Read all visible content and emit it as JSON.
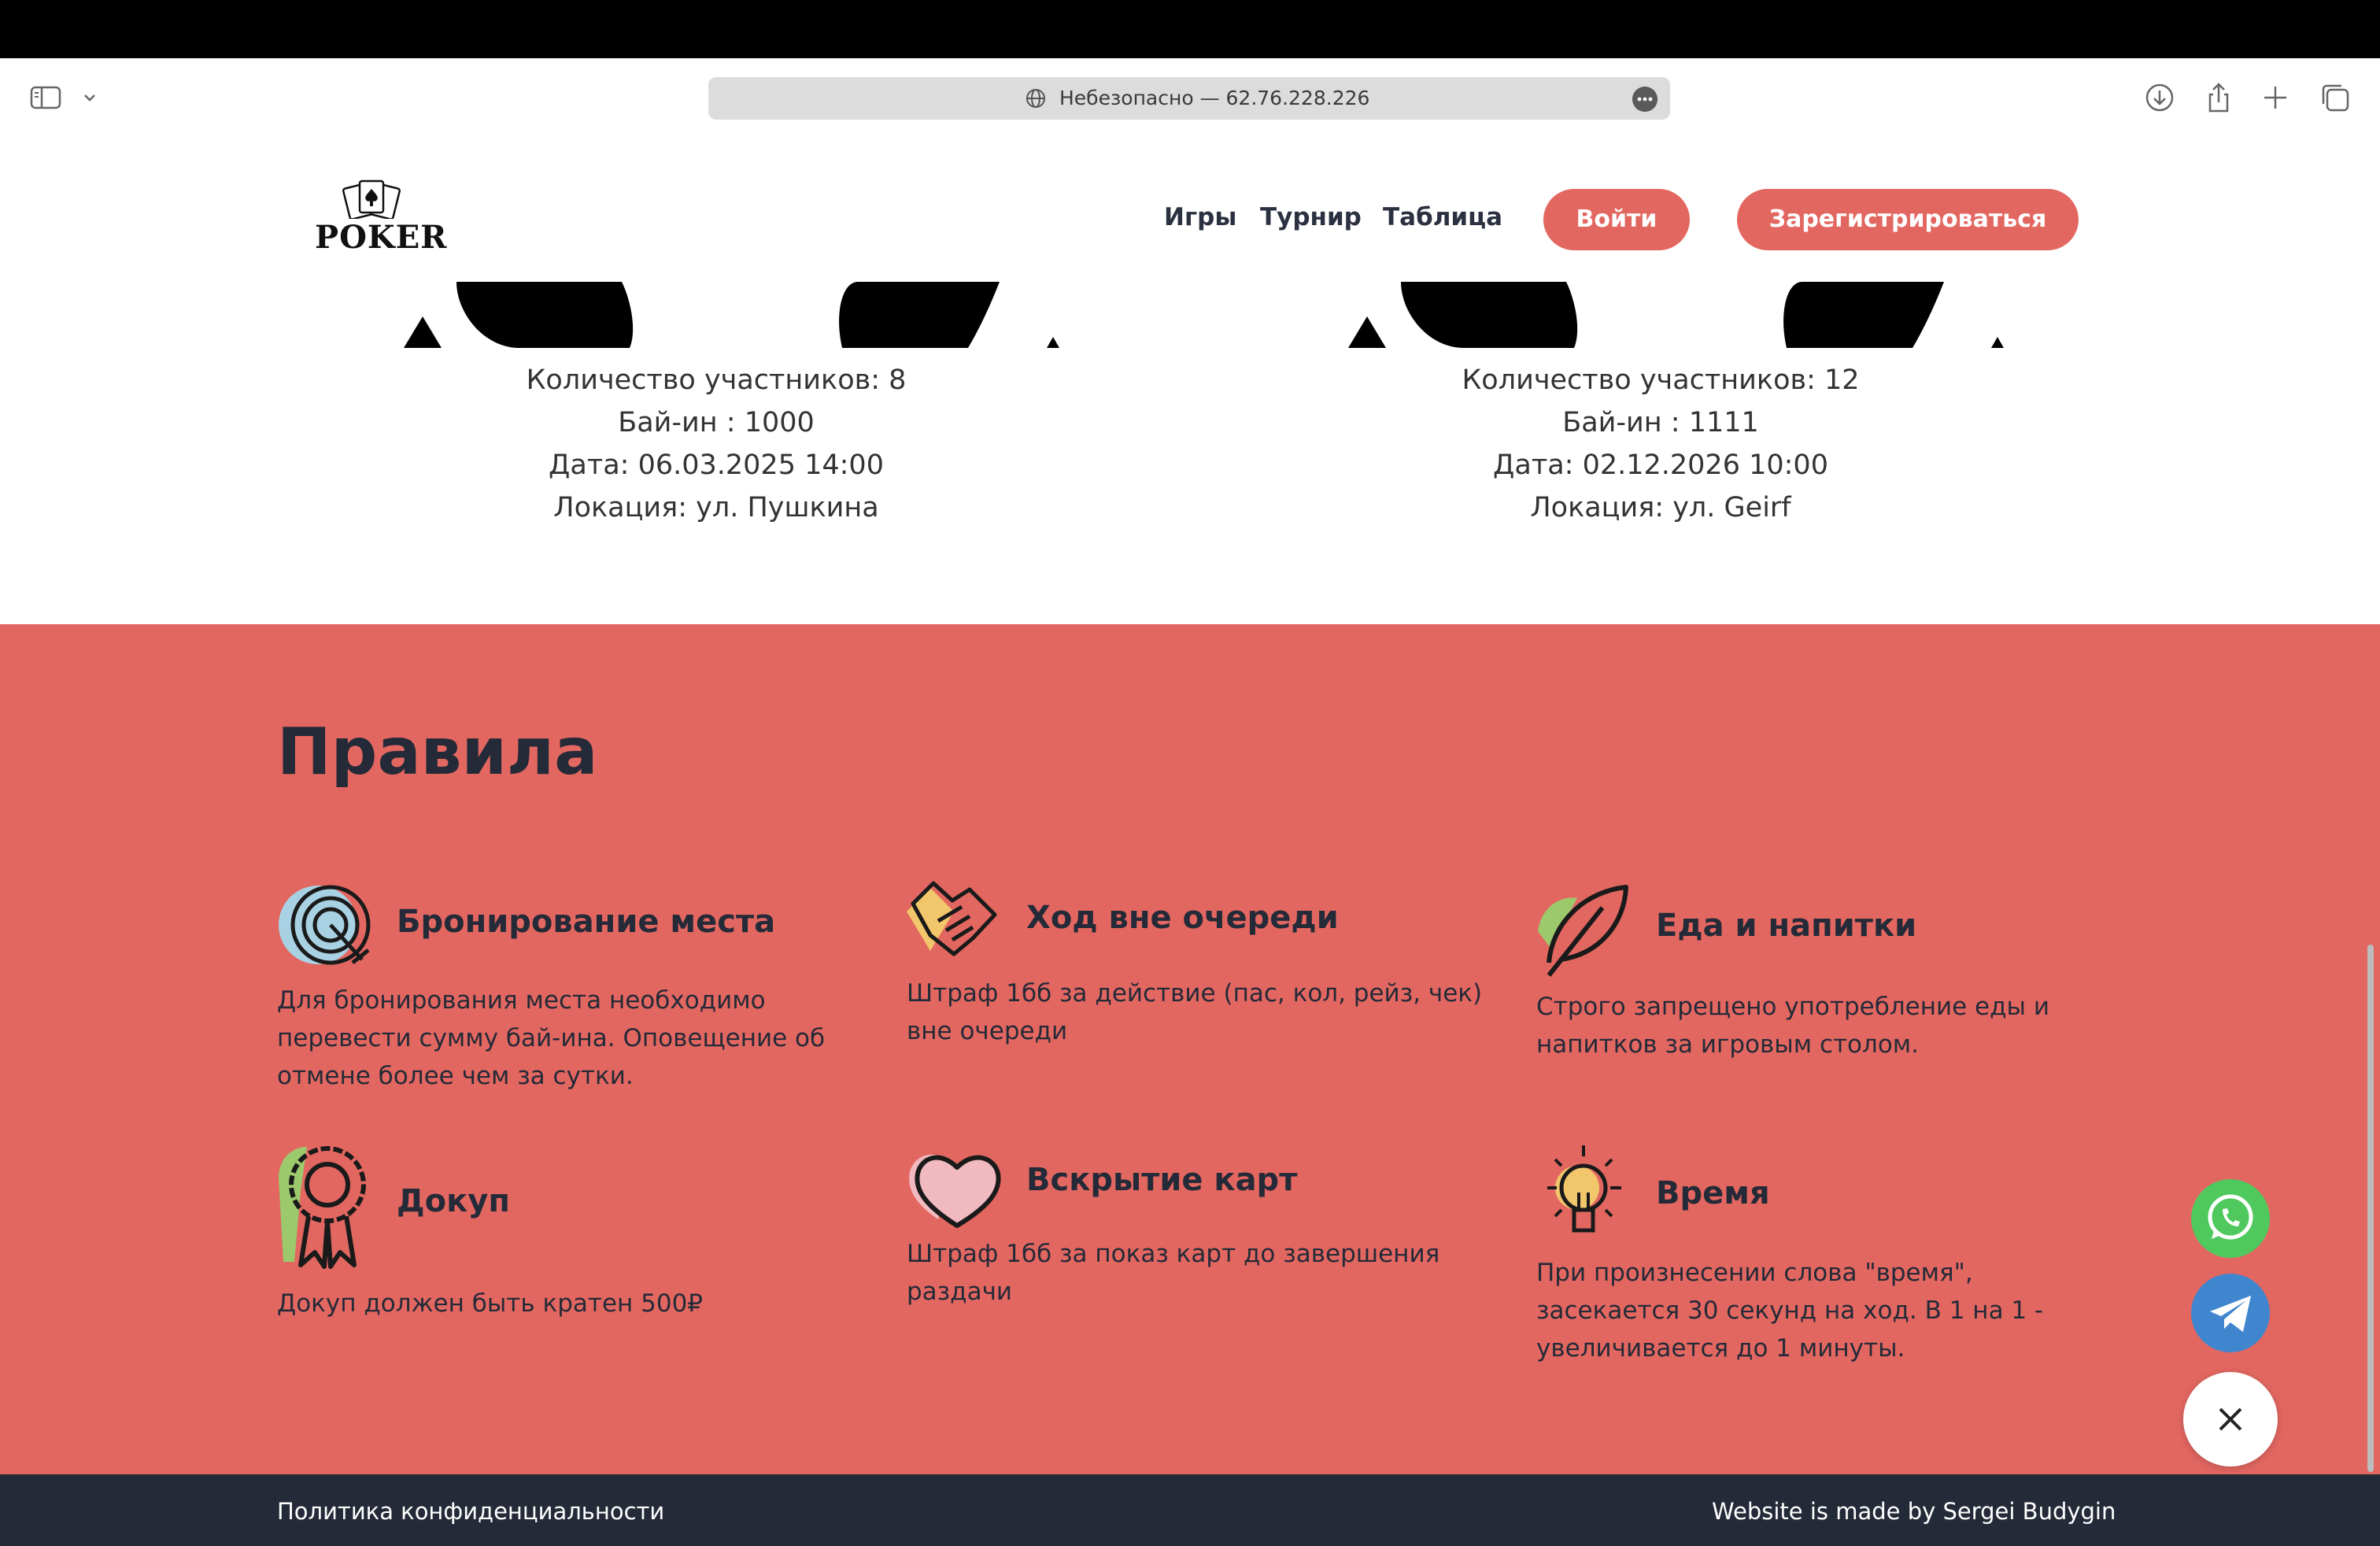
{
  "browser": {
    "address_label": "Небезопасно — 62.76.228.226",
    "icons": [
      "sidebar-icon",
      "chevron-down-icon",
      "globe-icon",
      "more-icon",
      "download-icon",
      "share-icon",
      "new-tab-icon",
      "tabs-overview-icon"
    ]
  },
  "header": {
    "logo_text": "POKER",
    "nav": {
      "games": "Игры",
      "tournament": "Турнир",
      "table": "Таблица"
    },
    "login": "Войти",
    "register": "Зарегистрироваться"
  },
  "tournaments": [
    {
      "participants": "Количество участников: 8",
      "buyin": "Бай-ин : 1000",
      "date": "Дата: 06.03.2025 14:00",
      "location": "Локация: ул. Пушкина"
    },
    {
      "participants": "Количество участников: 12",
      "buyin": "Бай-ин : 1111",
      "date": "Дата: 02.12.2026 10:00",
      "location": "Локация: ул. Geirf"
    }
  ],
  "rules": {
    "title": "Правила",
    "items": [
      {
        "icon": "target-icon",
        "title": "Бронирование места",
        "text": "Для бронирования места необходимо перевести сумму бай-ина. Оповещение об отмене более чем за сутки."
      },
      {
        "icon": "handshake-icon",
        "title": "Ход вне очереди",
        "text": "Штраф 1бб за действие (пас, кол, рейз, чек) вне очереди"
      },
      {
        "icon": "leaf-icon",
        "title": "Еда и напитки",
        "text": "Строго запрещено употребление еды и напитков за игровым столом."
      },
      {
        "icon": "award-icon",
        "title": "Докуп",
        "text": "Докуп должен быть кратен 500₽"
      },
      {
        "icon": "heart-icon",
        "title": "Вскрытие карт",
        "text": "Штраф 1бб за показ карт до завершения раздачи"
      },
      {
        "icon": "lightbulb-icon",
        "title": "Время",
        "text": "При произнесении слова \"время\", засекается 30 секунд на ход. В 1 на 1 - увеличивается до 1 минуты."
      }
    ]
  },
  "floating": {
    "whatsapp_color": "#4fc85d",
    "telegram_color": "#3f86cf",
    "close_color": "#ffffff"
  },
  "footer": {
    "privacy": "Политика конфиденциальности",
    "credit": "Website is made by Sergei Budygin"
  },
  "colors": {
    "accent": "#e36761",
    "dark": "#242a37"
  }
}
